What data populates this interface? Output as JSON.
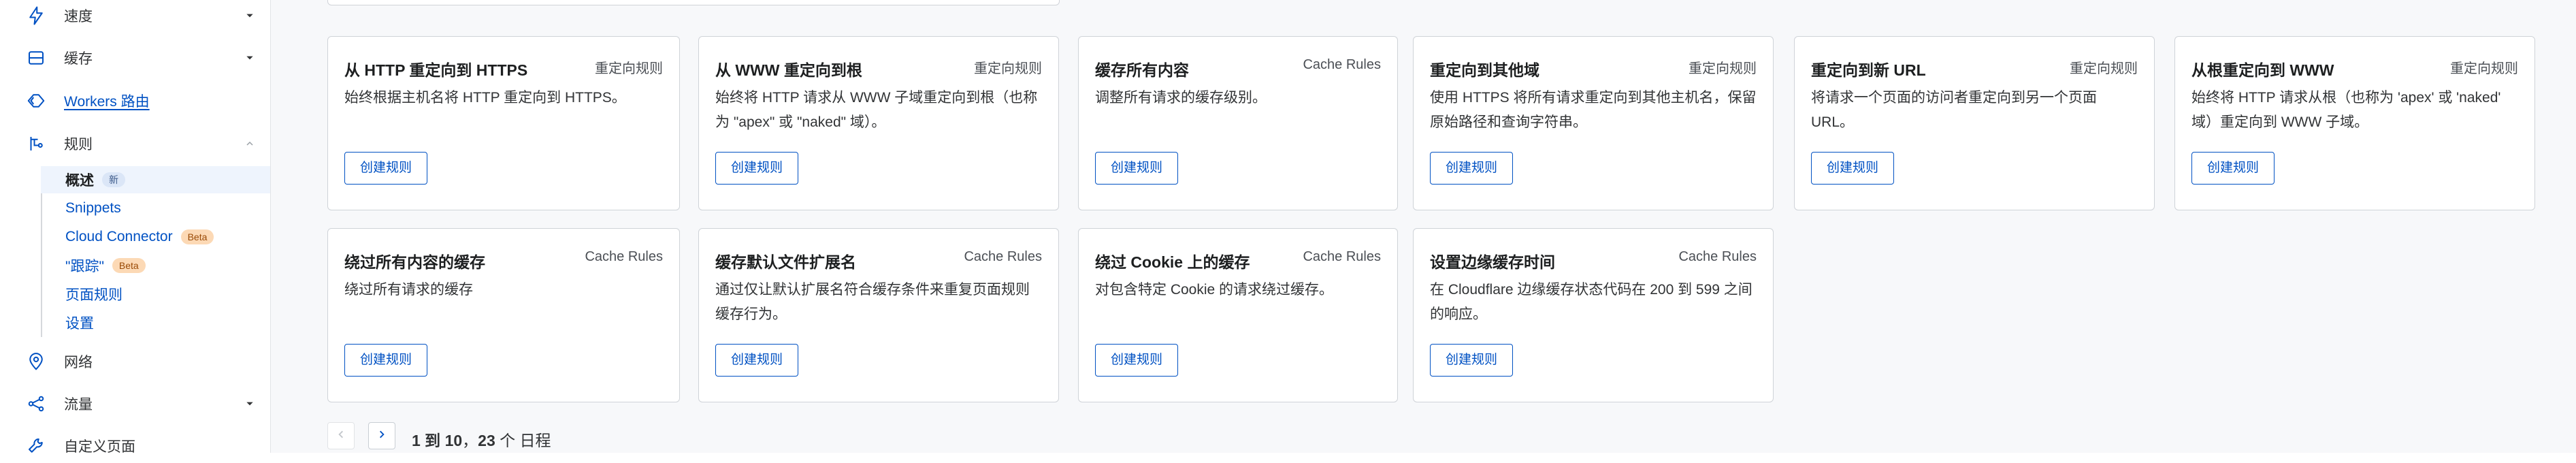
{
  "sidebar": {
    "items": [
      {
        "label": "速度",
        "icon": "lightning-icon",
        "chevron": true
      },
      {
        "label": "缓存",
        "icon": "storage-icon",
        "chevron": true
      },
      {
        "label": "Workers 路由",
        "icon": "workers-icon",
        "chevron": false
      },
      {
        "label": "规则",
        "icon": "rules-icon",
        "chevron": true
      },
      {
        "label": "网络",
        "icon": "network-pin-icon",
        "chevron": false
      },
      {
        "label": "流量",
        "icon": "traffic-icon",
        "chevron": true
      },
      {
        "label": "自定义页面",
        "icon": "wrench-icon",
        "chevron": false
      }
    ],
    "rules_sub": [
      {
        "label": "概述",
        "badge": "新"
      },
      {
        "label": "Snippets"
      },
      {
        "label": "Cloud Connector",
        "badge": "Beta"
      },
      {
        "label": "\"跟踪\"",
        "badge": "Beta"
      },
      {
        "label": "页面规则"
      },
      {
        "label": "设置"
      }
    ]
  },
  "cards": [
    {
      "title": "从 HTTP 重定向到 HTTPS",
      "tag": "重定向规则",
      "desc": "始终根据主机名将 HTTP 重定向到 HTTPS。",
      "button": "创建规则"
    },
    {
      "title": "从 WWW 重定向到根",
      "tag": "重定向规则",
      "desc": "始终将 HTTP 请求从 WWW 子域重定向到根（也称为 \"apex\" 或 \"naked\" 域）。",
      "button": "创建规则"
    },
    {
      "title": "缓存所有内容",
      "tag": "Cache Rules",
      "desc": "调整所有请求的缓存级别。",
      "button": "创建规则"
    },
    {
      "title": "重定向到其他域",
      "tag": "重定向规则",
      "desc": "使用 HTTPS 将所有请求重定向到其他主机名，保留原始路径和查询字符串。",
      "button": "创建规则"
    },
    {
      "title": "重定向到新 URL",
      "tag": "重定向规则",
      "desc": "将请求一个页面的访问者重定向到另一个页面 URL。",
      "button": "创建规则"
    },
    {
      "title": "从根重定向到 WWW",
      "tag": "重定向规则",
      "desc": "始终将 HTTP 请求从根（也称为 'apex' 或 'naked' 域）重定向到 WWW 子域。",
      "button": "创建规则"
    },
    {
      "title": "绕过所有内容的缓存",
      "tag": "Cache Rules",
      "desc": "绕过所有请求的缓存",
      "button": "创建规则"
    },
    {
      "title": "缓存默认文件扩展名",
      "tag": "Cache Rules",
      "desc": "通过仅让默认扩展名符合缓存条件来重复页面规则缓存行为。",
      "button": "创建规则"
    },
    {
      "title": "绕过 Cookie 上的缓存",
      "tag": "Cache Rules",
      "desc": "对包含特定 Cookie 的请求绕过缓存。",
      "button": "创建规则"
    },
    {
      "title": "设置边缘缓存时间",
      "tag": "Cache Rules",
      "desc": "在 Cloudflare 边缘缓存状态代码在 200 到 599 之间的响应。",
      "button": "创建规则"
    }
  ],
  "pagination": {
    "range": "1 到 10",
    "separator": "，",
    "total": "23",
    "unit": "个 日程"
  },
  "colors": {
    "accent": "#0051c3",
    "beta_badge": "#fcd9b5",
    "new_badge": "#dbe6f7"
  }
}
